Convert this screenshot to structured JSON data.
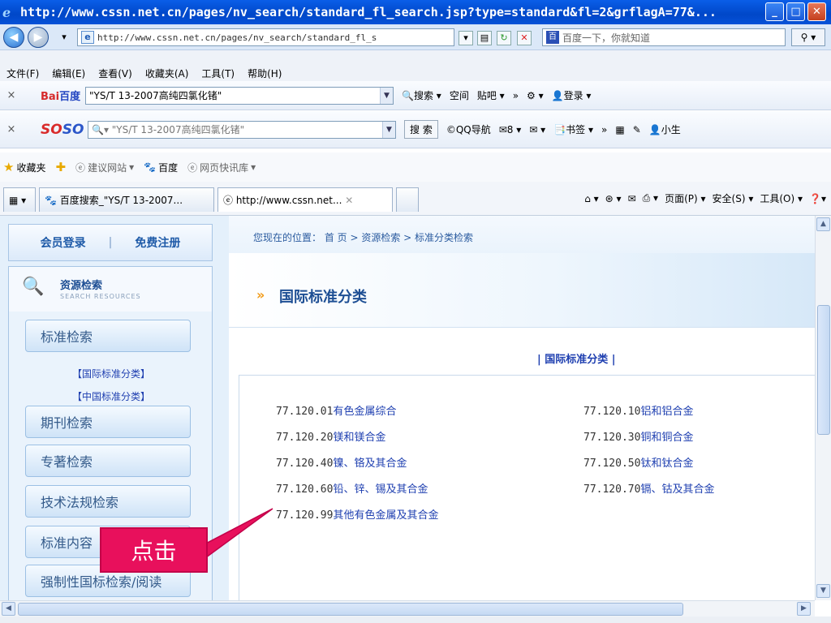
{
  "window": {
    "title": "http://www.cssn.net.cn/pages/nv_search/standard_fl_search.jsp?type=standard&fl=2&grflagA=77&..."
  },
  "address": {
    "url": "http://www.cssn.net.cn/pages/nv_search/standard_fl_s",
    "search_placeholder": "百度一下，你就知道"
  },
  "menu": [
    "文件(F)",
    "编辑(E)",
    "查看(V)",
    "收藏夹(A)",
    "工具(T)",
    "帮助(H)"
  ],
  "baidu_bar": {
    "logo_a": "Bai",
    "logo_b": "百度",
    "query": "\"YS/T 13-2007高纯四氯化锗\"",
    "search_label": "搜索",
    "items": [
      "空间",
      "贴吧",
      "»",
      "登录"
    ]
  },
  "soso_bar": {
    "logo_a": "SO",
    "logo_b": "SO",
    "query": "\"YS/T 13-2007高纯四氯化锗\"",
    "search_label": "搜 索",
    "items": [
      "QQ导航",
      "8",
      "书签",
      "»",
      "小生"
    ]
  },
  "favorites": {
    "label": "收藏夹",
    "items": [
      "建议网站",
      "百度",
      "网页快讯库"
    ]
  },
  "tabs": [
    {
      "label": "百度搜索_\"YS/T 13-2007..."
    },
    {
      "label": "http://www.cssn.net..."
    }
  ],
  "command_bar": [
    "页面(P)",
    "安全(S)",
    "工具(O)"
  ],
  "sidebar": {
    "login": "会员登录",
    "separator": "|",
    "register": "免费注册",
    "resources_title": "资源检索",
    "resources_subtitle": "SEARCH RESOURCES",
    "buttons": [
      "标准检索",
      "期刊检索",
      "专著检索",
      "技术法规检索",
      "标准内容",
      "强制性国标检索/阅读"
    ],
    "sublinks": [
      "【国际标准分类】",
      "【中国标准分类】"
    ]
  },
  "breadcrumb": "您现在的位置： 首 页 > 资源检索 > 标准分类检索",
  "section_title": "国际标准分类",
  "pipe_title": "| 国际标准分类 |",
  "items": [
    {
      "code": "77.120.01",
      "name": "有色金属综合"
    },
    {
      "code": "77.120.10",
      "name": "铝和铝合金"
    },
    {
      "code": "77.120.20",
      "name": "镁和镁合金"
    },
    {
      "code": "77.120.30",
      "name": "铜和铜合金"
    },
    {
      "code": "77.120.40",
      "name": "镍、铬及其合金"
    },
    {
      "code": "77.120.50",
      "name": "钛和钛合金"
    },
    {
      "code": "77.120.60",
      "name": "铅、锌、锡及其合金"
    },
    {
      "code": "77.120.70",
      "name": "镉、钴及其合金"
    },
    {
      "code": "77.120.99",
      "name": "其他有色金属及其合金"
    }
  ],
  "callout": "点击",
  "colors": {
    "link": "#1e3fb0",
    "callout": "#e8105c",
    "heading": "#1e4f94"
  }
}
